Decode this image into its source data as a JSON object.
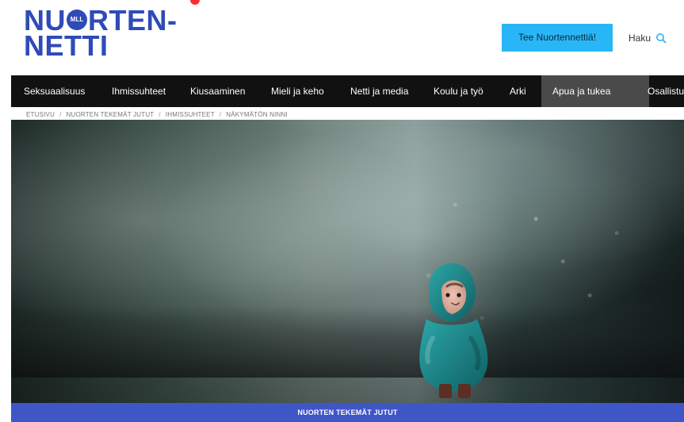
{
  "header": {
    "logo": {
      "line1_left": "NU",
      "line1_badge": "MLL",
      "line1_right": "RTEN-",
      "line2": "NETTI"
    },
    "cta_label": "Tee Nuortennettiä!",
    "search_label": "Haku",
    "search_icon": "search-icon",
    "accent_color": "#29b6f6",
    "brand_color": "#2f4bb8"
  },
  "nav": {
    "items": [
      {
        "label": "Seksuaalisuus"
      },
      {
        "label": "Ihmissuhteet"
      },
      {
        "label": "Kiusaaminen"
      },
      {
        "label": "Mieli ja keho"
      },
      {
        "label": "Netti ja media"
      },
      {
        "label": "Koulu ja työ"
      },
      {
        "label": "Arki"
      },
      {
        "label": "Apua ja tukea",
        "active": true
      },
      {
        "label": "Osallistu"
      }
    ]
  },
  "breadcrumb": {
    "items": [
      "Etusivu",
      "Nuorten tekemät jutut",
      "Ihmissuhteet",
      "Näkymätön Ninni"
    ],
    "separator": "/"
  },
  "hero": {
    "image_alt": "",
    "category_label": "NUORTEN TEKEMÄT JUTUT"
  }
}
